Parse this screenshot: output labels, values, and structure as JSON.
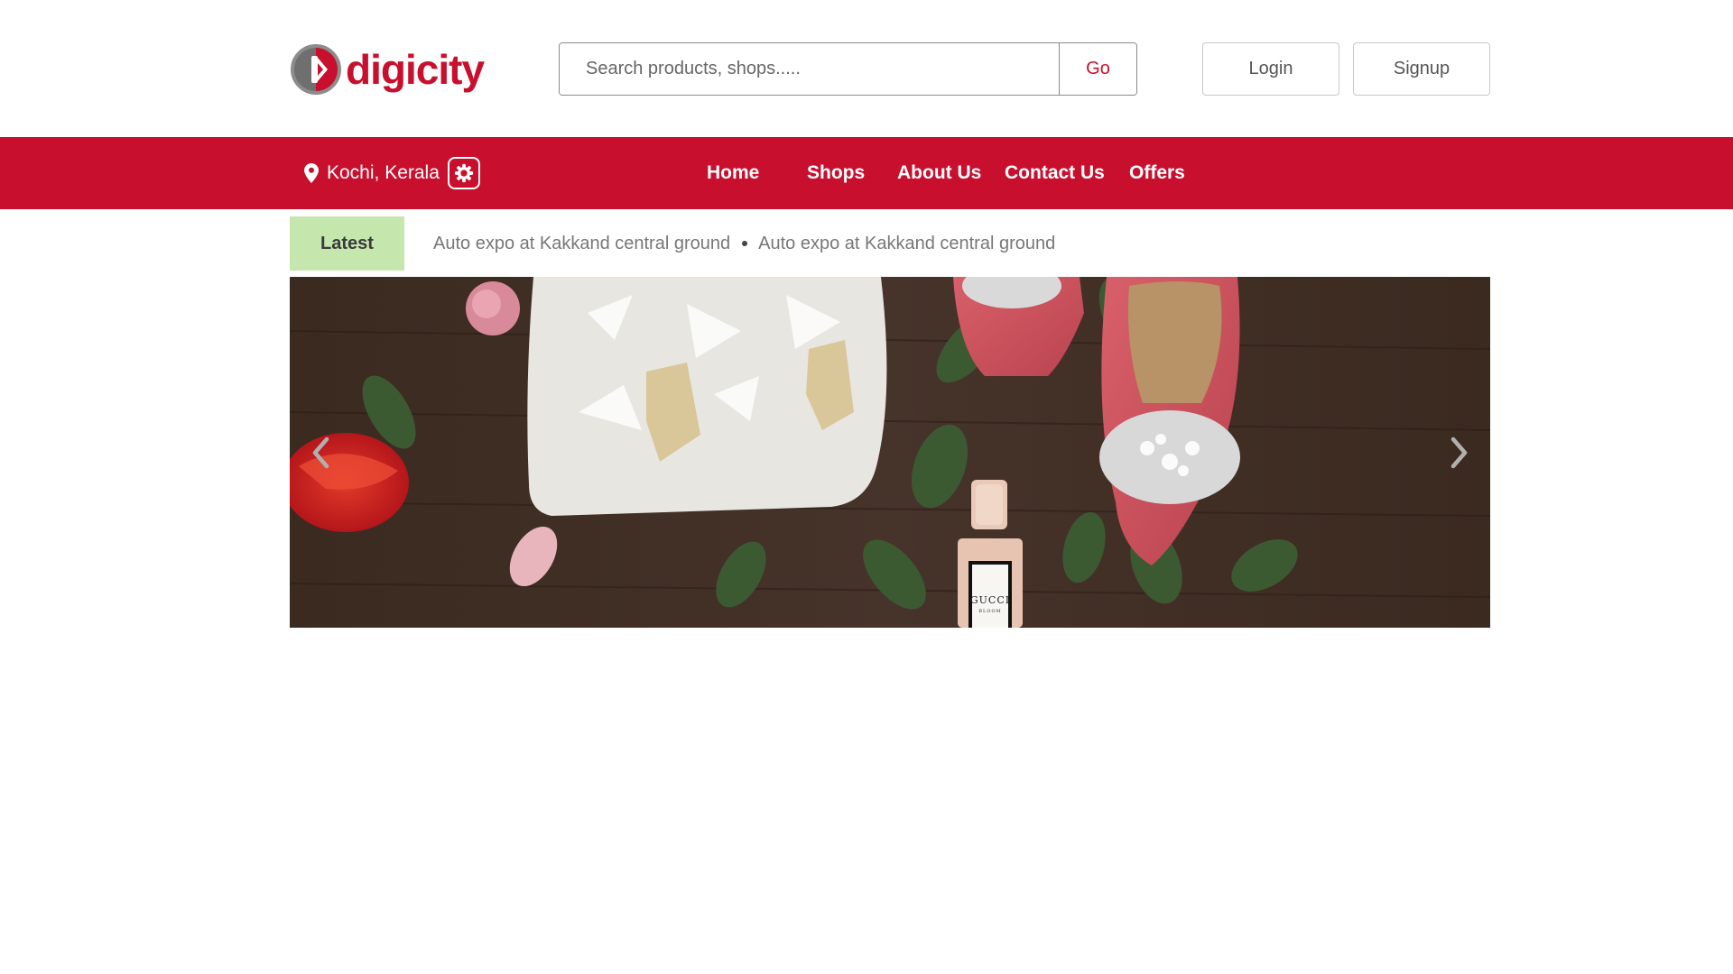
{
  "brand": {
    "name": "digicity",
    "color": "#c8102e"
  },
  "search": {
    "placeholder": "Search products, shops.....",
    "value": "",
    "button_label": "Go"
  },
  "auth": {
    "login_label": "Login",
    "signup_label": "Signup"
  },
  "navbar": {
    "background": "#c8102e",
    "location": {
      "icon": "map-pin-icon",
      "text": "Kochi, Kerala",
      "settings_icon": "gear-icon"
    },
    "links": [
      {
        "label": "Home"
      },
      {
        "label": "Shops"
      },
      {
        "label": "About Us"
      },
      {
        "label": "Contact Us"
      },
      {
        "label": "Offers"
      }
    ]
  },
  "ticker": {
    "label": "Latest",
    "label_background": "#c5e6ad",
    "items": [
      "Auto expo at Kakkand central ground",
      "Auto expo at Kakkand central ground"
    ]
  },
  "slider": {
    "prev_icon": "chevron-left-icon",
    "next_icon": "chevron-right-icon",
    "image_contents": "flat lay photo: beaded white clutch, pink heels with crystal brooches, roses, leaves, perfume bottle",
    "bottle_label": "GUCCI",
    "bottle_sublabel": "BLOOM"
  }
}
